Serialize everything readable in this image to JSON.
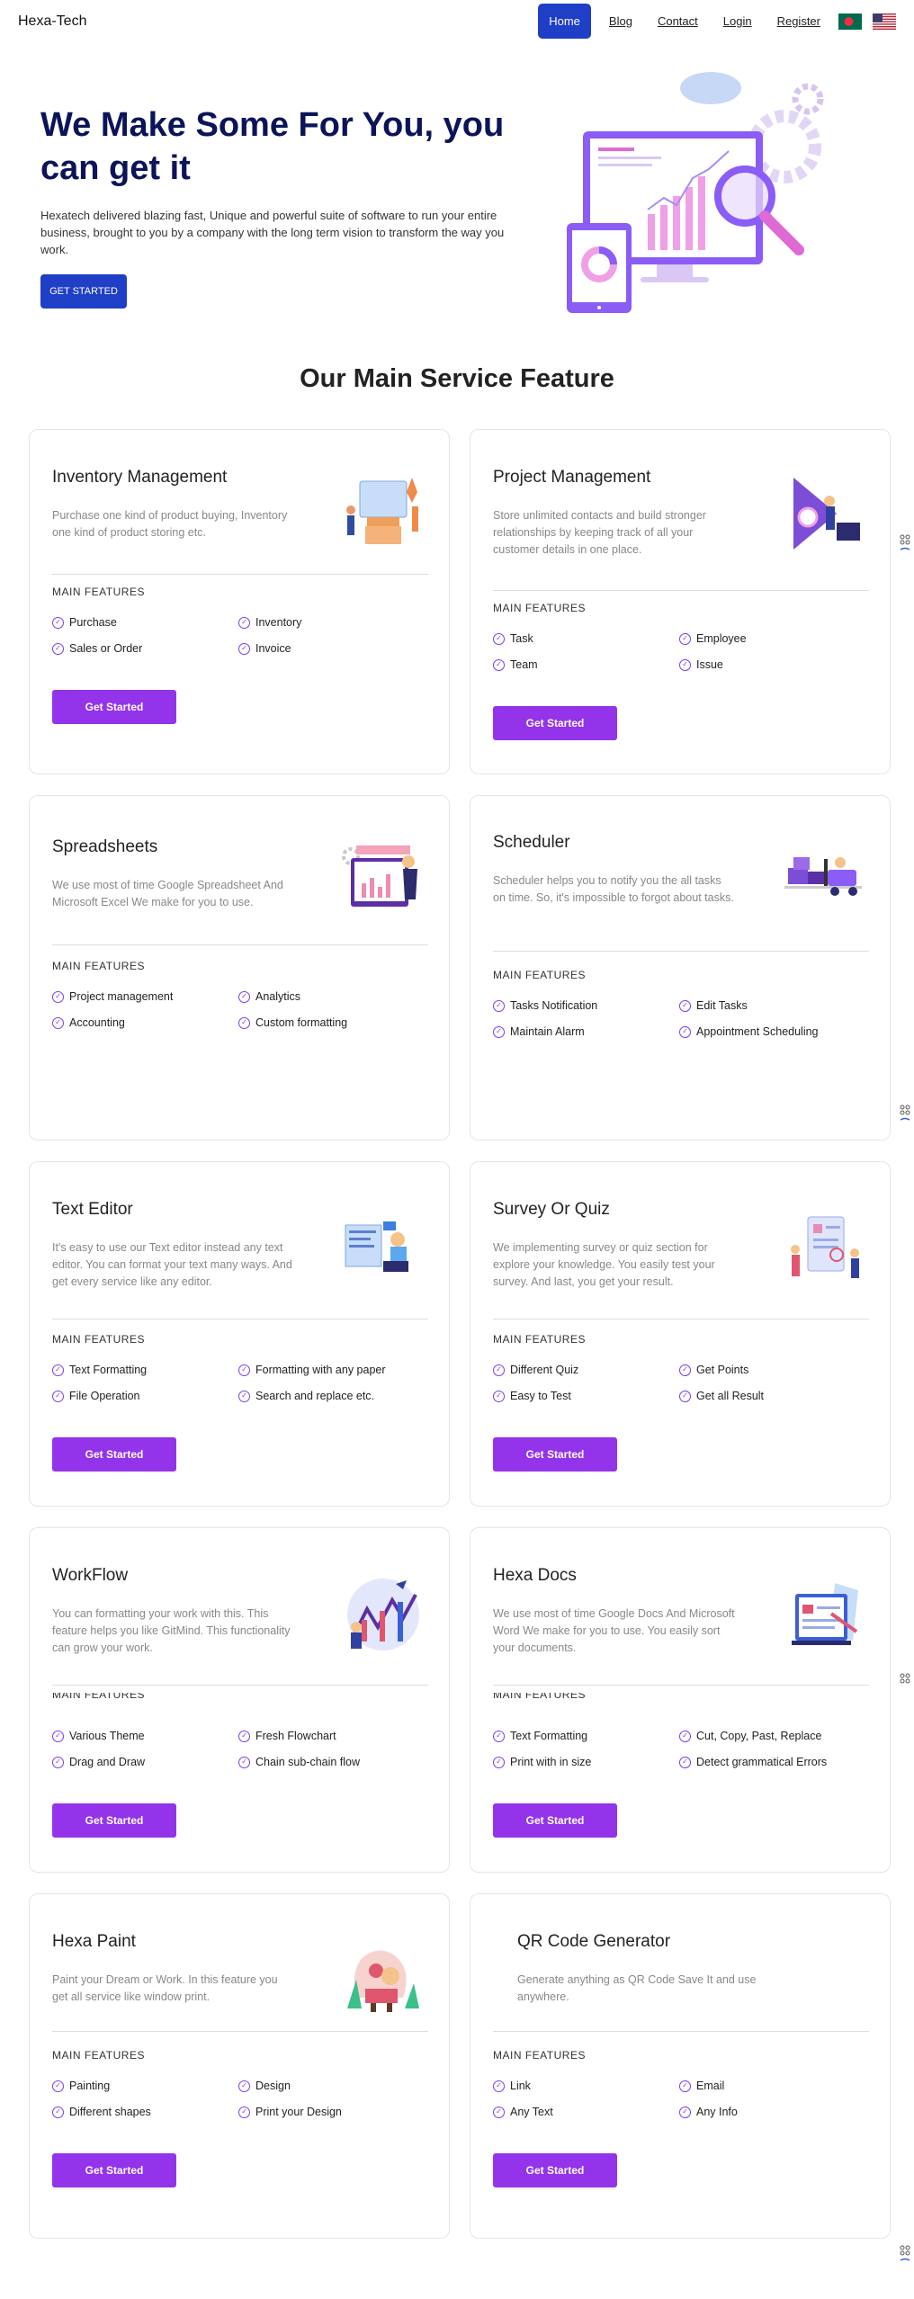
{
  "navbar": {
    "brand": "Hexa-Tech",
    "home": "Home",
    "links": [
      "Blog",
      "Contact",
      "Login",
      "Register"
    ]
  },
  "hero": {
    "title": "We Make Some For You, you can get it",
    "description": "Hexatech delivered blazing fast, Unique and powerful suite of software to run your entire business, brought to you by a company with the long term vision to transform the way you work.",
    "button": "GET STARTED"
  },
  "section": {
    "title": "Our Main Service Feature"
  },
  "colors": {
    "primary": "#1f3fc6",
    "accent": "#9333ea",
    "title": "#0c1459"
  },
  "cards": [
    {
      "title": "Inventory Management",
      "description": "Purchase one kind of product buying, Inventory one kind of product storing etc.",
      "features_label": "MAIN FEATURES",
      "features": [
        "Purchase",
        "Inventory",
        "Sales or Order",
        "Invoice"
      ],
      "button": "Get Started"
    },
    {
      "title": "Project Management",
      "description": "Store unlimited contacts and build stronger relationships by keeping track of all your customer details in one place.",
      "features_label": "MAIN FEATURES",
      "features": [
        "Task",
        "Employee",
        "Team",
        "Issue"
      ],
      "button": "Get Started"
    },
    {
      "title": "Spreadsheets",
      "description": "We use most of time Google Spreadsheet And Microsoft Excel We make for you to use.",
      "features_label": "MAIN FEATURES",
      "features": [
        "Project management",
        "Analytics",
        "Accounting",
        "Custom formatting"
      ],
      "button": ""
    },
    {
      "title": "Scheduler",
      "description": "Scheduler helps you to notify you the all tasks on time. So, it's impossible to forgot about tasks.",
      "features_label": "MAIN FEATURES",
      "features": [
        "Tasks Notification",
        "Edit Tasks",
        "Maintain Alarm",
        "Appointment Scheduling"
      ],
      "button": ""
    },
    {
      "title": "Text Editor",
      "description": "It's easy to use our Text editor instead any text editor. You can format your text many ways. And get every service like any editor.",
      "features_label": "MAIN FEATURES",
      "features": [
        "Text Formatting",
        "Formatting with any paper",
        "File Operation",
        "Search and replace etc."
      ],
      "button": "Get Started"
    },
    {
      "title": "Survey Or Quiz",
      "description": "We implementing survey or quiz section for explore your knowledge. You easily test your survey. And last, you get your result.",
      "features_label": "MAIN FEATURES",
      "features": [
        "Different Quiz",
        "Get Points",
        "Easy to Test",
        "Get all Result"
      ],
      "button": "Get Started"
    },
    {
      "title": "WorkFlow",
      "description": "You can formatting your work with this. This feature helps you like GitMind. This functionality can grow your work.",
      "features_label": "MAIN FEATURES",
      "features": [
        "Various Theme",
        "Fresh Flowchart",
        "Drag and Draw",
        "Chain sub-chain flow"
      ],
      "button": "Get Started"
    },
    {
      "title": "Hexa Docs",
      "description": "We use most of time Google Docs And Microsoft Word We make for you to use. You easily sort your documents.",
      "features_label": "MAIN FEATURES",
      "features": [
        "Text Formatting",
        "Cut, Copy, Past, Replace",
        "Print with in size",
        "Detect grammatical Errors"
      ],
      "button": "Get Started"
    },
    {
      "title": "Hexa Paint",
      "description": "Paint your Dream or Work. In this feature you get all service like window print.",
      "features_label": "MAIN FEATURES",
      "features": [
        "Painting",
        "Design",
        "Different shapes",
        "Print your Design"
      ],
      "button": "Get Started"
    },
    {
      "title": "QR Code Generator",
      "description": "Generate anything as QR Code Save It and use anywhere.",
      "features_label": "MAIN FEATURES",
      "features": [
        "Link",
        "Email",
        "Any Text",
        "Any Info"
      ],
      "button": "Get Started"
    }
  ]
}
